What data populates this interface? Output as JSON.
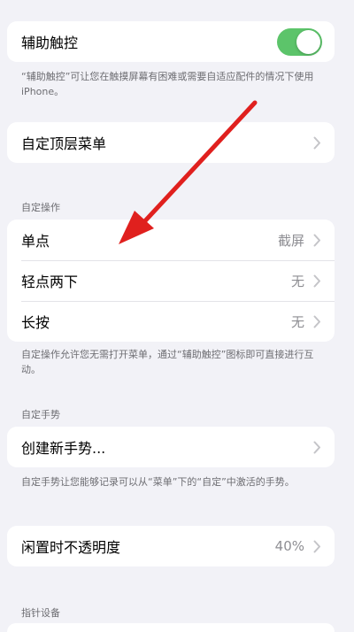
{
  "assistive_touch": {
    "label": "辅助触控",
    "toggle_on": true,
    "description": "“辅助触控”可让您在触摸屏幕有困难或需要自适应配件的情况下使用 iPhone。"
  },
  "top_menu": {
    "label": "自定顶层菜单"
  },
  "custom_actions": {
    "header": "自定操作",
    "items": [
      {
        "label": "单点",
        "value": "截屏"
      },
      {
        "label": "轻点两下",
        "value": "无"
      },
      {
        "label": "长按",
        "value": "无"
      }
    ],
    "footer": "自定操作允许您无需打开菜单，通过“辅助触控”图标即可直接进行互动。"
  },
  "custom_gestures": {
    "header": "自定手势",
    "create_label": "创建新手势...",
    "footer": "自定手势让您能够记录可以从“菜单”下的“自定”中激活的手势。"
  },
  "idle_opacity": {
    "label": "闲置时不透明度",
    "value": "40%"
  },
  "pointer_devices": {
    "header": "指针设备"
  },
  "colors": {
    "toggle_on": "#5cc46a",
    "arrow": "#e0201e"
  }
}
